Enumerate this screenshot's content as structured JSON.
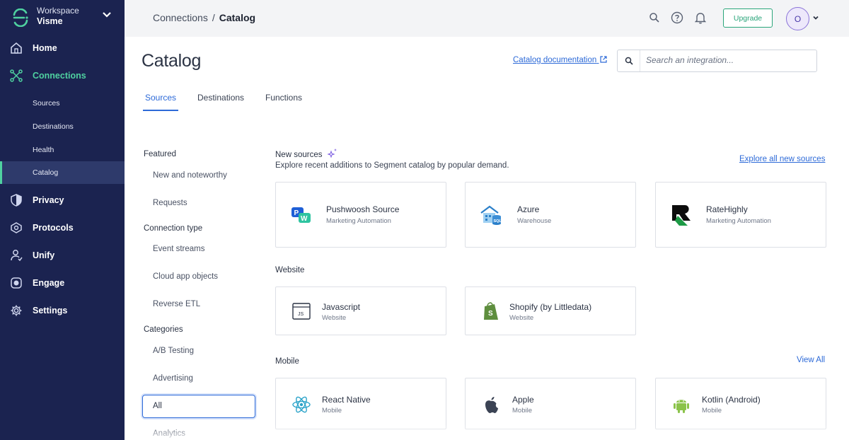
{
  "workspace": {
    "label": "Workspace",
    "name": "Visme"
  },
  "sidebar": {
    "items": [
      {
        "label": "Home",
        "icon": "home-icon"
      },
      {
        "label": "Connections",
        "icon": "connections-icon"
      },
      {
        "label": "Privacy",
        "icon": "shield-icon"
      },
      {
        "label": "Protocols",
        "icon": "protocols-icon"
      },
      {
        "label": "Unify",
        "icon": "unify-icon"
      },
      {
        "label": "Engage",
        "icon": "engage-icon"
      },
      {
        "label": "Settings",
        "icon": "gear-icon"
      }
    ],
    "subitems": [
      {
        "label": "Sources"
      },
      {
        "label": "Destinations"
      },
      {
        "label": "Health"
      },
      {
        "label": "Catalog"
      }
    ]
  },
  "topbar": {
    "breadcrumb_parent": "Connections",
    "breadcrumb_sep": "/",
    "breadcrumb_current": "Catalog",
    "upgrade_label": "Upgrade",
    "avatar_initial": "O"
  },
  "main": {
    "title": "Catalog",
    "doc_link": "Catalog documentation",
    "search_placeholder": "Search an integration...",
    "tabs": [
      {
        "label": "Sources"
      },
      {
        "label": "Destinations"
      },
      {
        "label": "Functions"
      }
    ]
  },
  "filters": {
    "featured_heading": "Featured",
    "featured": [
      "New and noteworthy",
      "Requests"
    ],
    "connection_heading": "Connection type",
    "connection": [
      "Event streams",
      "Cloud app objects",
      "Reverse ETL"
    ],
    "categories_heading": "Categories",
    "categories": [
      "A/B Testing",
      "Advertising",
      "All",
      "Analytics"
    ]
  },
  "sections": {
    "new_sources": {
      "title": "New sources",
      "subtitle": "Explore recent additions to Segment catalog by popular demand.",
      "link": "Explore all new sources",
      "cards": [
        {
          "name": "Pushwoosh Source",
          "sub": "Marketing Automation",
          "icon": "pushwoosh-logo"
        },
        {
          "name": "Azure",
          "sub": "Warehouse",
          "icon": "azure-sql-logo"
        },
        {
          "name": "RateHighly",
          "sub": "Marketing Automation",
          "icon": "ratehighly-logo"
        }
      ]
    },
    "website": {
      "title": "Website",
      "cards": [
        {
          "name": "Javascript",
          "sub": "Website",
          "icon": "javascript-logo"
        },
        {
          "name": "Shopify (by Littledata)",
          "sub": "Website",
          "icon": "shopify-logo"
        }
      ]
    },
    "mobile": {
      "title": "Mobile",
      "link": "View All",
      "cards": [
        {
          "name": "React Native",
          "sub": "Mobile",
          "icon": "react-logo"
        },
        {
          "name": "Apple",
          "sub": "Mobile",
          "icon": "apple-logo"
        },
        {
          "name": "Kotlin (Android)",
          "sub": "Mobile",
          "icon": "android-logo"
        }
      ]
    }
  },
  "colors": {
    "sidebar_bg": "#1b2350",
    "accent_green": "#4fd1a0",
    "link_blue": "#2d6ad8",
    "upgrade_green": "#2aa57a",
    "avatar_purple": "#8a73d8"
  }
}
